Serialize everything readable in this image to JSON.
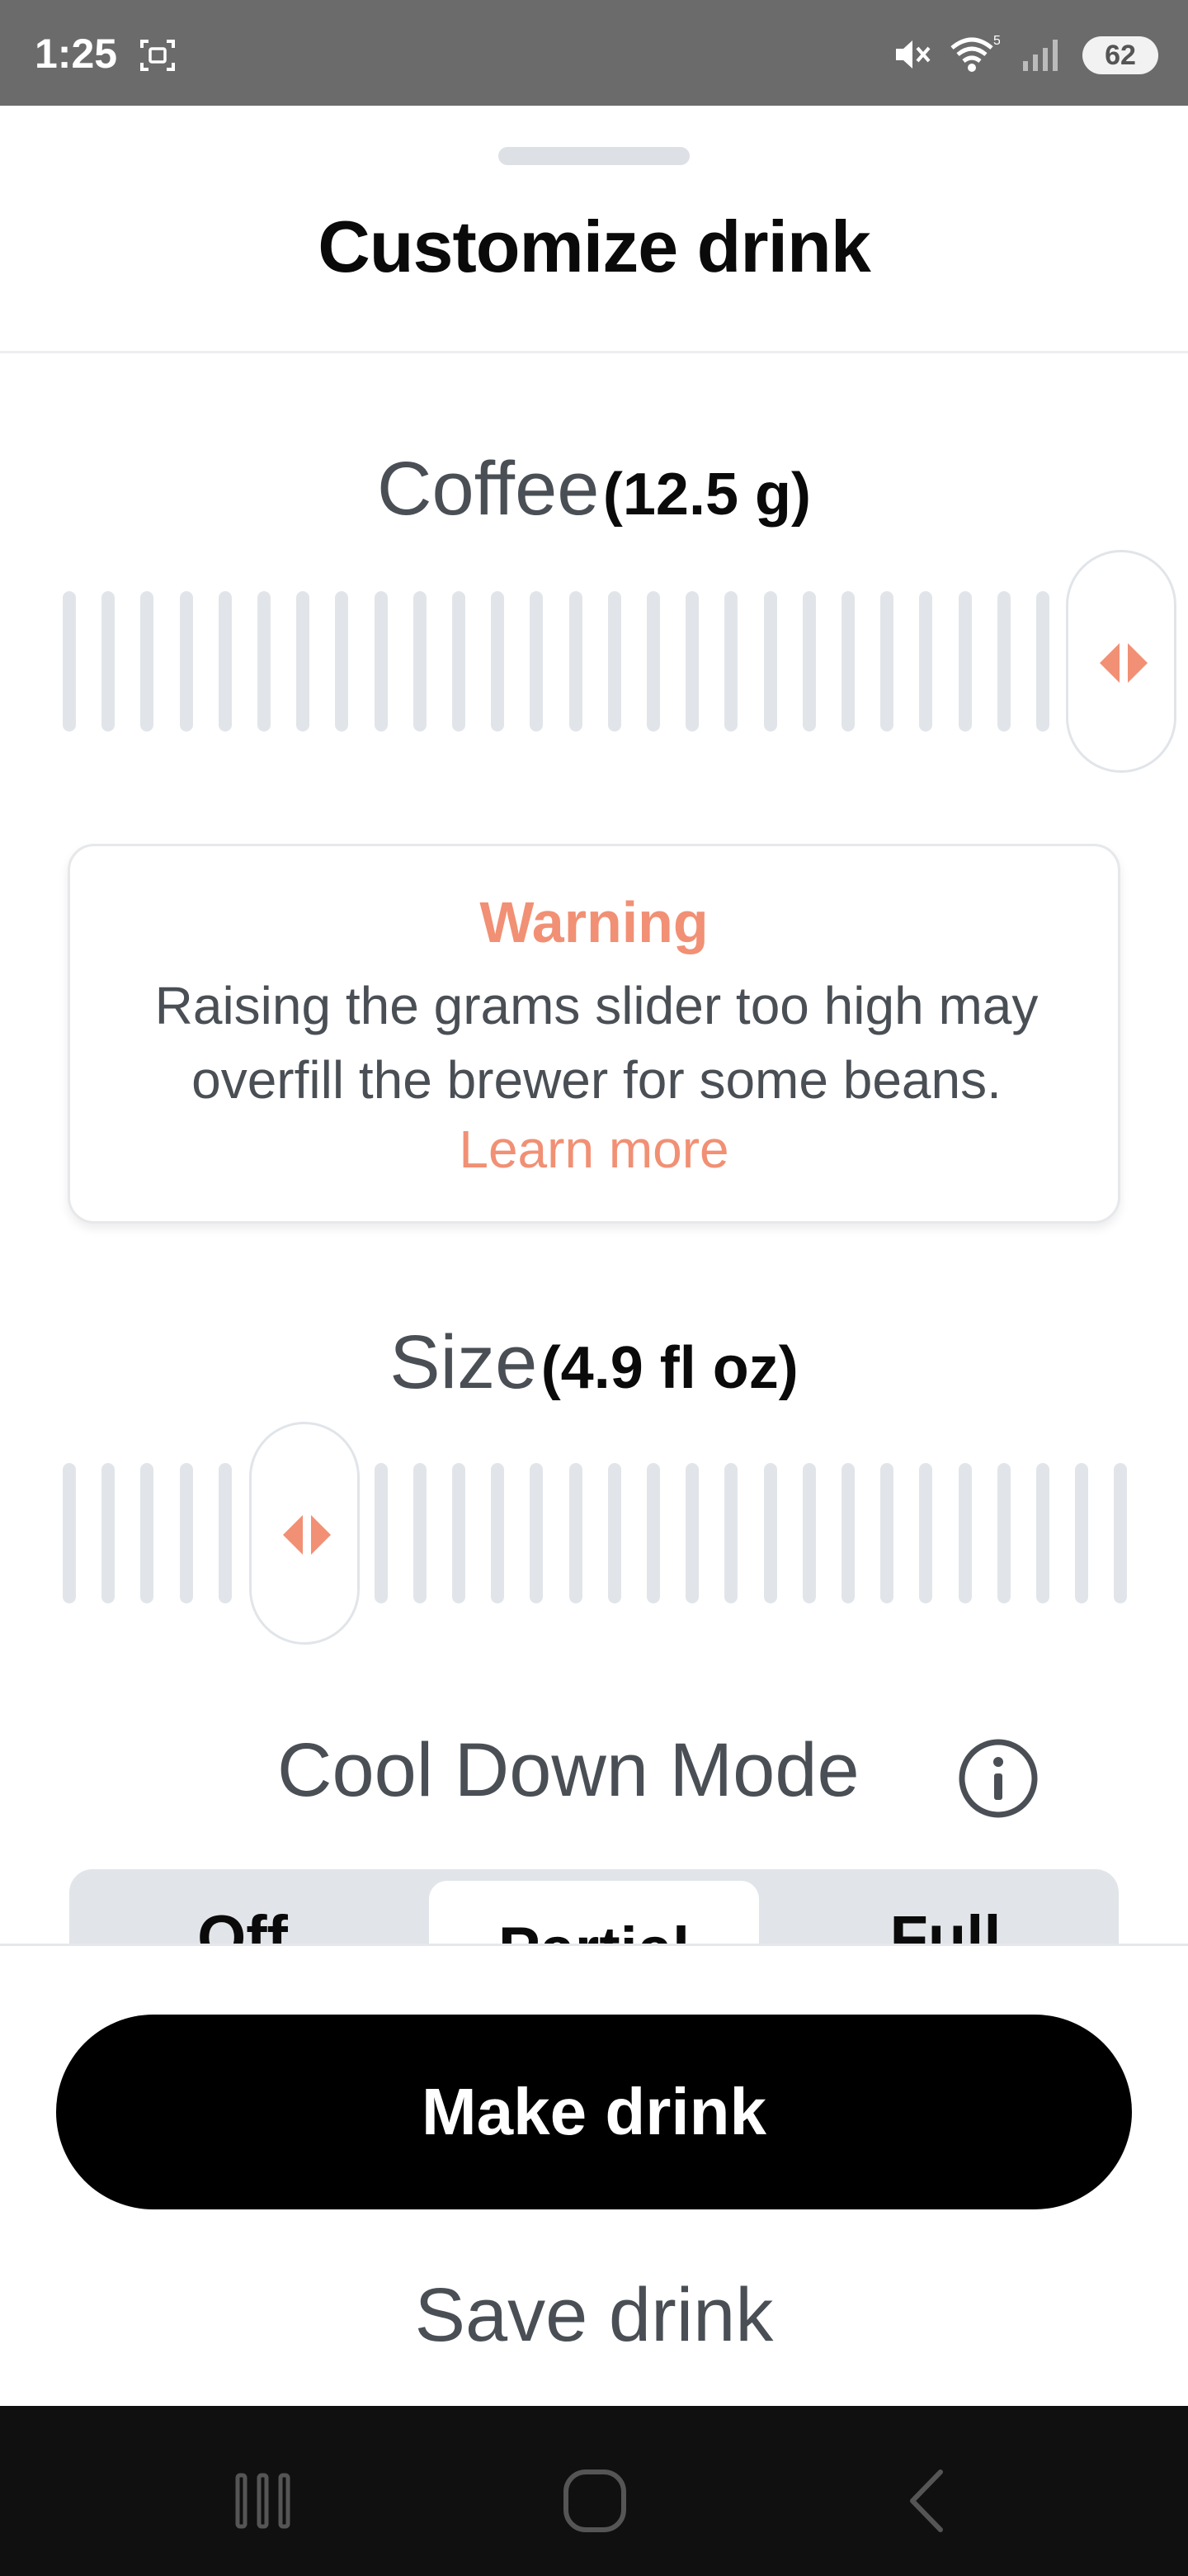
{
  "status_bar": {
    "time": "1:25",
    "battery": "62",
    "wifi_badge": "5"
  },
  "sheet": {
    "title": "Customize drink"
  },
  "coffee_slider": {
    "name": "Coffee",
    "value_label": "(12.5 g)",
    "level": 1.0
  },
  "warning": {
    "title": "Warning",
    "body": "Raising the grams slider too high may overfill the brewer for some beans.",
    "link": "Learn more"
  },
  "size_slider": {
    "name": "Size",
    "value_label": "(4.9 fl oz)",
    "level": 0.2
  },
  "cool_down": {
    "label": "Cool Down Mode",
    "options": [
      "Off",
      "Partial",
      "Full"
    ],
    "selected": "Partial"
  },
  "actions": {
    "make_label": "Make drink",
    "save_label": "Save drink"
  },
  "colors": {
    "accent": "#f19074",
    "tick": "#e1e5e9",
    "primary_button": "#000000"
  },
  "icons": {
    "screenshot": "screenshot-icon",
    "mute": "mute-icon",
    "wifi": "wifi-icon",
    "signal": "signal-icon",
    "info": "info-icon",
    "thumb": "slider-arrows-icon",
    "nav_recents": "recents-icon",
    "nav_home": "home-icon",
    "nav_back": "back-icon"
  }
}
